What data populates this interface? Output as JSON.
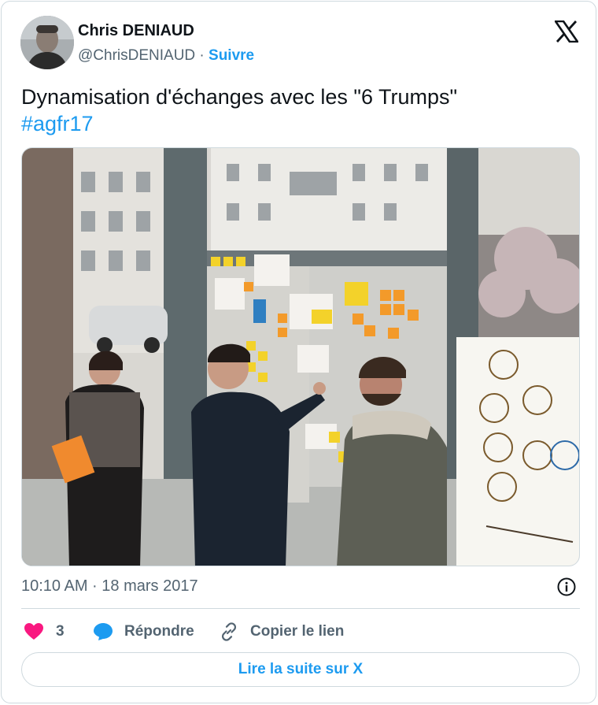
{
  "author": {
    "name": "Chris DENIAUD",
    "handle": "@ChrisDENIAUD",
    "separator": "·",
    "follow_label": "Suivre",
    "avatar": "profile-photo"
  },
  "brand_icon": "x-logo-icon",
  "tweet": {
    "text": "Dynamisation d'échanges avec les \"6 Trumps\"",
    "hashtag": "#agfr17",
    "timestamp": "10:10 AM · 18 mars 2017"
  },
  "actions": {
    "like_count": "3",
    "reply_label": "Répondre",
    "copy_label": "Copier le lien"
  },
  "read_more_label": "Lire la suite sur X",
  "colors": {
    "accent": "#1d9bf0",
    "like": "#f91880",
    "secondary_text": "#536471",
    "border": "#cfd9de"
  }
}
